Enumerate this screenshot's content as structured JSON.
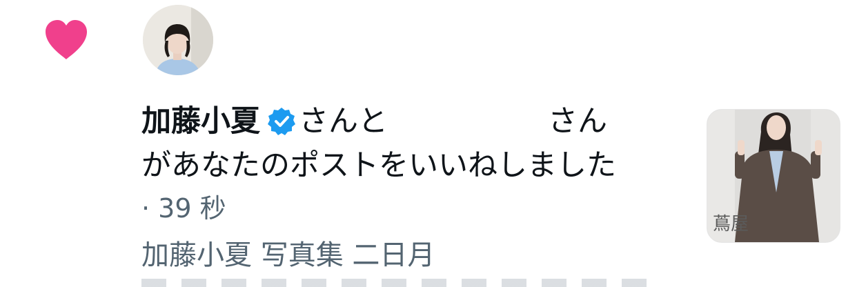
{
  "notification": {
    "type_icon": "heart-icon",
    "type_color": "#f0408c",
    "avatar_icon": "user-avatar",
    "user_name": "加藤小夏",
    "verified_icon": "verified-badge-icon",
    "verified_color": "#1d9bf0",
    "connector_1": "さんと",
    "connector_2": "さん",
    "action_text": "があなたのポストをいいねしました",
    "time": "· 39 秒",
    "post_preview": "加藤小夏 写真集 二日月",
    "media_thumbnail_text": "蔦屋"
  }
}
